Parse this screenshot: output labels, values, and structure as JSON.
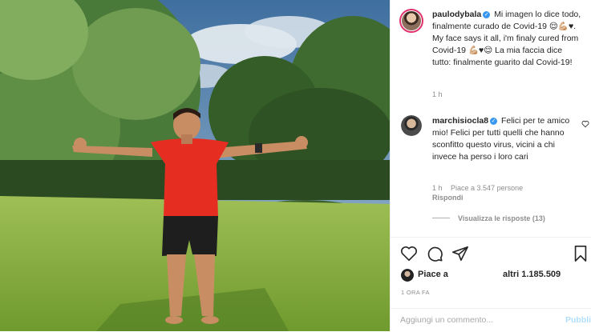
{
  "post": {
    "username": "paulodybala",
    "caption": "Mi imagen lo dice todo, finalmente curado de Covid-19 😌💪🏼♥. My face says it all, i'm finaly cured from Covid-19 💪🏼♥😌 La mia faccia dice tutto: finalmente guarito dal Covid-19!",
    "time": "1 h"
  },
  "comment": {
    "username": "marchisiocla8",
    "text": "Felici per te amico mio! Felici per tutti quelli che hanno sconfitto questo virus, vicini a chi invece ha perso i loro cari",
    "time": "1 h",
    "likes": "Piace a 3.547 persone",
    "reply": "Rispondi",
    "view_replies": "Visualizza le risposte (13)"
  },
  "likes": {
    "label": "Piace a",
    "others": "altri 1.185.509"
  },
  "post_date": "1 ORA FA",
  "comment_box": {
    "placeholder": "Aggiungi un commento...",
    "publish": "Pubblica"
  },
  "colors": {
    "accent_blue": "#3897f0",
    "publish_disabled": "#b2dffc",
    "meta_gray": "#8e8e8e"
  },
  "icons": {
    "verified": "verified-badge-icon",
    "heart": "heart-icon",
    "comment": "comment-icon",
    "share": "share-icon",
    "save": "bookmark-icon"
  }
}
